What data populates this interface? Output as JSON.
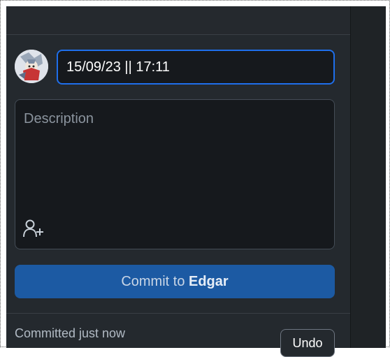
{
  "commit": {
    "summary_value": "15/09/23 || 17:11",
    "description_placeholder": "Description",
    "button_prefix": "Commit to",
    "branch": "Edgar"
  },
  "status": {
    "text": "Committed just now",
    "undo_label": "Undo"
  },
  "icons": {
    "avatar": "user-avatar",
    "coauthor": "add-coauthor-icon"
  },
  "colors": {
    "panel_bg": "#24292e",
    "input_bg": "#16191d",
    "focus_border": "#1f6feb",
    "commit_button": "#1c5aa3"
  }
}
